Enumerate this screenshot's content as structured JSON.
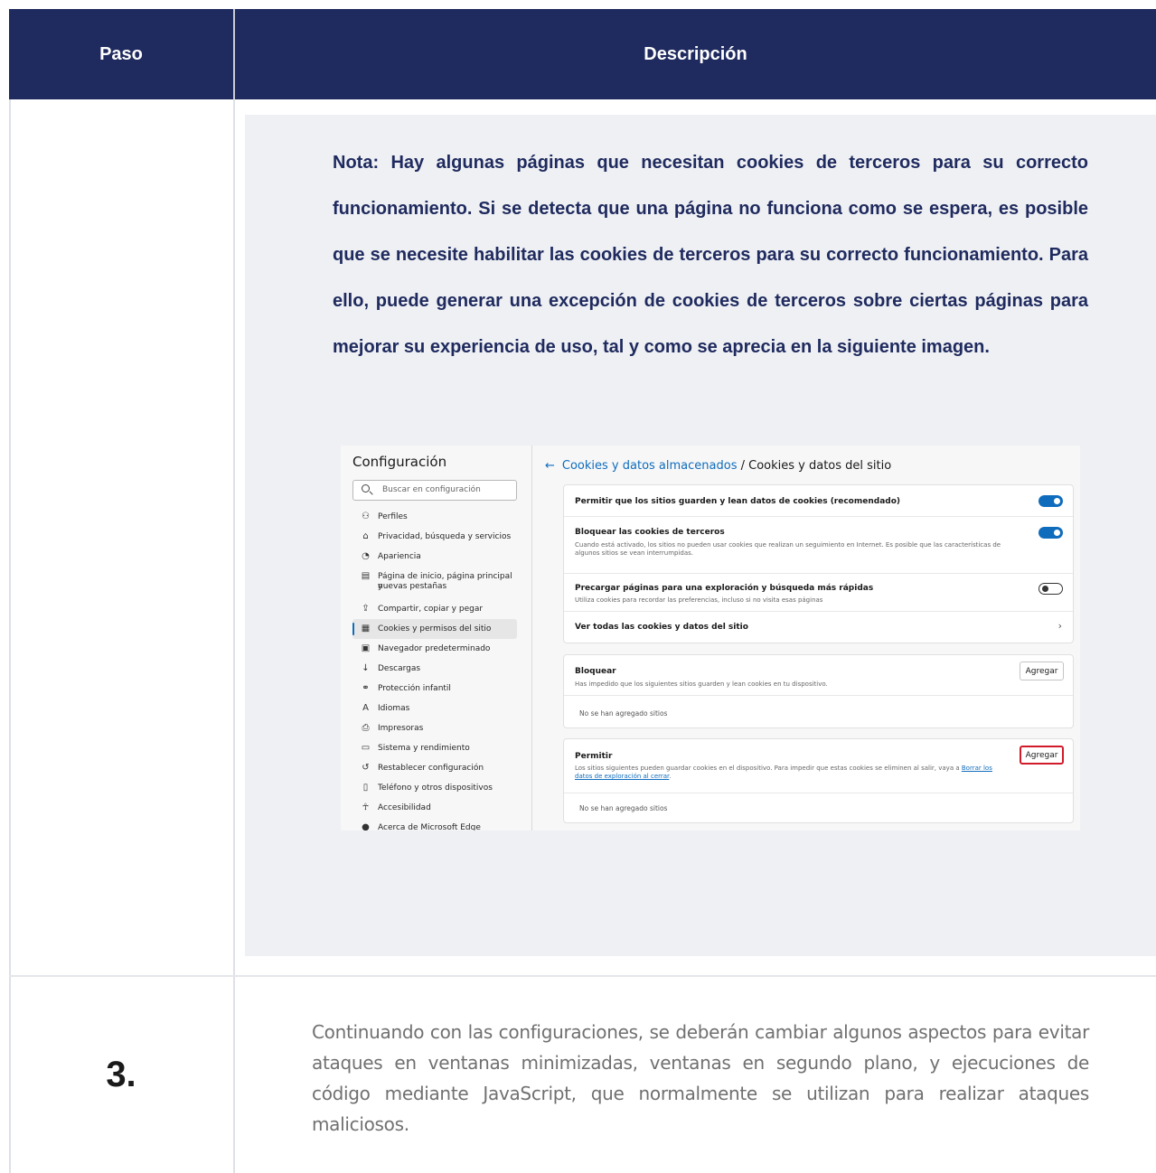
{
  "table": {
    "header": {
      "step": "Paso",
      "description": "Descripción"
    },
    "note": "Nota: Hay algunas páginas que necesitan cookies de terceros para su correcto funcionamiento. Si se detecta que una página no funciona como se espera, es posible que se necesite habilitar las cookies de terceros para su correcto funcionamiento. Para ello, puede generar una excepción de cookies de terceros sobre ciertas páginas para mejorar su experiencia de uso, tal y como se aprecia en la siguiente imagen.",
    "step3": {
      "number": "3.",
      "text": "Continuando con las configuraciones, se deberán cambiar algunos aspectos para evitar ataques en ventanas minimizadas, ventanas en segundo plano, y ejecuciones de código mediante JavaScript, que normalmente se utilizan para realizar ataques maliciosos."
    }
  },
  "screenshot": {
    "sidebar": {
      "title": "Configuración",
      "search_placeholder": "Buscar en configuración",
      "items": [
        {
          "label": "Perfiles",
          "icon": "profile-icon"
        },
        {
          "label": "Privacidad, búsqueda y servicios",
          "icon": "lock-icon"
        },
        {
          "label": "Apariencia",
          "icon": "appearance-icon"
        },
        {
          "label": "Página de inicio, página principal y",
          "label2": "nuevas pestañas",
          "icon": "home-page-icon"
        },
        {
          "label": "Compartir, copiar y pegar",
          "icon": "share-icon"
        },
        {
          "label": "Cookies y permisos del sitio",
          "icon": "cookies-icon",
          "active": true
        },
        {
          "label": "Navegador predeterminado",
          "icon": "browser-icon"
        },
        {
          "label": "Descargas",
          "icon": "download-icon"
        },
        {
          "label": "Protección infantil",
          "icon": "family-icon"
        },
        {
          "label": "Idiomas",
          "icon": "language-icon"
        },
        {
          "label": "Impresoras",
          "icon": "printer-icon"
        },
        {
          "label": "Sistema y rendimiento",
          "icon": "laptop-icon"
        },
        {
          "label": "Restablecer configuración",
          "icon": "reset-icon"
        },
        {
          "label": "Teléfono y otros dispositivos",
          "icon": "phone-icon"
        },
        {
          "label": "Accesibilidad",
          "icon": "accessibility-icon"
        },
        {
          "label": "Acerca de Microsoft Edge",
          "icon": "edge-icon"
        }
      ]
    },
    "breadcrumb": {
      "back": "←",
      "parent": "Cookies y datos almacenados",
      "separator": " / ",
      "current": "Cookies y datos del sitio"
    },
    "settings": {
      "allow_cookies": {
        "title": "Permitir que los sitios guarden y lean datos de cookies (recomendado)",
        "on": true
      },
      "block_third_party": {
        "title": "Bloquear las cookies de terceros",
        "desc": "Cuando está activado, los sitios no pueden usar cookies que realizan un seguimiento en Internet. Es posible que las características de algunos sitios se vean interrumpidas.",
        "on": true
      },
      "preload": {
        "title": "Precargar páginas para una exploración y búsqueda más rápidas",
        "desc": "Utiliza cookies para recordar las preferencias, incluso si no visita esas páginas",
        "on": false
      },
      "see_all": {
        "title": "Ver todas las cookies y datos del sitio",
        "chevron": "›"
      }
    },
    "block": {
      "title": "Bloquear",
      "desc": "Has impedido que los siguientes sitios guarden y lean cookies en tu dispositivo.",
      "add_label": "Agregar",
      "empty": "No se han agregado sitios"
    },
    "allow": {
      "title": "Permitir",
      "desc_prefix": "Los sitios siguientes pueden guardar cookies en el dispositivo. Para impedir que estas cookies se eliminen al salir, vaya a ",
      "desc_link": "Borrar los datos de exploración al cerrar",
      "desc_suffix": ".",
      "add_label": "Agregar",
      "empty": "No se han agregado sitios"
    },
    "colors": {
      "accent": "#0f6cbd",
      "highlight": "#d11a2a",
      "header_bg": "#1f2a5e"
    }
  }
}
